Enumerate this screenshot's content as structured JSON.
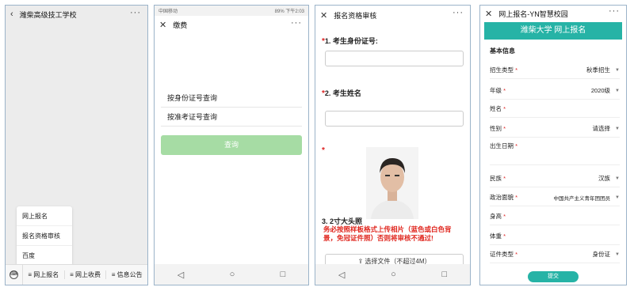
{
  "p1": {
    "title": "潍柴高级技工学校",
    "more": "···",
    "menu": [
      "网上报名",
      "报名资格审核",
      "百度"
    ],
    "tabs": [
      "≡ 网上报名",
      "≡ 网上收费",
      "≡ 信息公告"
    ]
  },
  "p2": {
    "status_left": "中国移动",
    "status_right": "89% 下午2:03",
    "title": "缴费",
    "more": "···",
    "opt1": "按身份证号查询",
    "opt2": "按准考证号查询",
    "query_btn": "查询"
  },
  "p3": {
    "title": "报名资格审核",
    "more": "···",
    "q1": "1. 考生身份证号:",
    "q2": "2. 考生姓名",
    "q3": "3. 2寸大头照",
    "warning": "务必按照样板格式上传相片（蓝色或白色背景，免冠证件照）否则将审核不通过!",
    "upload": "选择文件（不超过4M）"
  },
  "p4": {
    "title": "网上报名-YN智慧校园",
    "more": "···",
    "banner": "潍柴大学 网上报名",
    "section": "基本信息",
    "rows": [
      {
        "label": "招生类型",
        "req": "*",
        "value": "秋季招生",
        "arrow": "▼"
      },
      {
        "label": "年级",
        "req": "*",
        "value": "2020级",
        "arrow": "▼"
      },
      {
        "label": "姓名",
        "req": "*",
        "value": "",
        "arrow": ""
      },
      {
        "label": "性别",
        "req": "*",
        "value": "请选择",
        "arrow": "▼"
      },
      {
        "label": "出生日期",
        "req": "*",
        "value": "",
        "arrow": ""
      },
      {
        "label": "民族",
        "req": "*",
        "value": "汉族",
        "arrow": "▼"
      },
      {
        "label": "政治面貌",
        "req": "*",
        "value": "中国共产主义青年团团员",
        "arrow": "▼"
      },
      {
        "label": "身高",
        "req": "*",
        "value": "",
        "arrow": ""
      },
      {
        "label": "体重",
        "req": "*",
        "value": "",
        "arrow": ""
      },
      {
        "label": "证件类型",
        "req": "*",
        "value": "身份证",
        "arrow": "▼"
      }
    ],
    "submit": "提交"
  }
}
